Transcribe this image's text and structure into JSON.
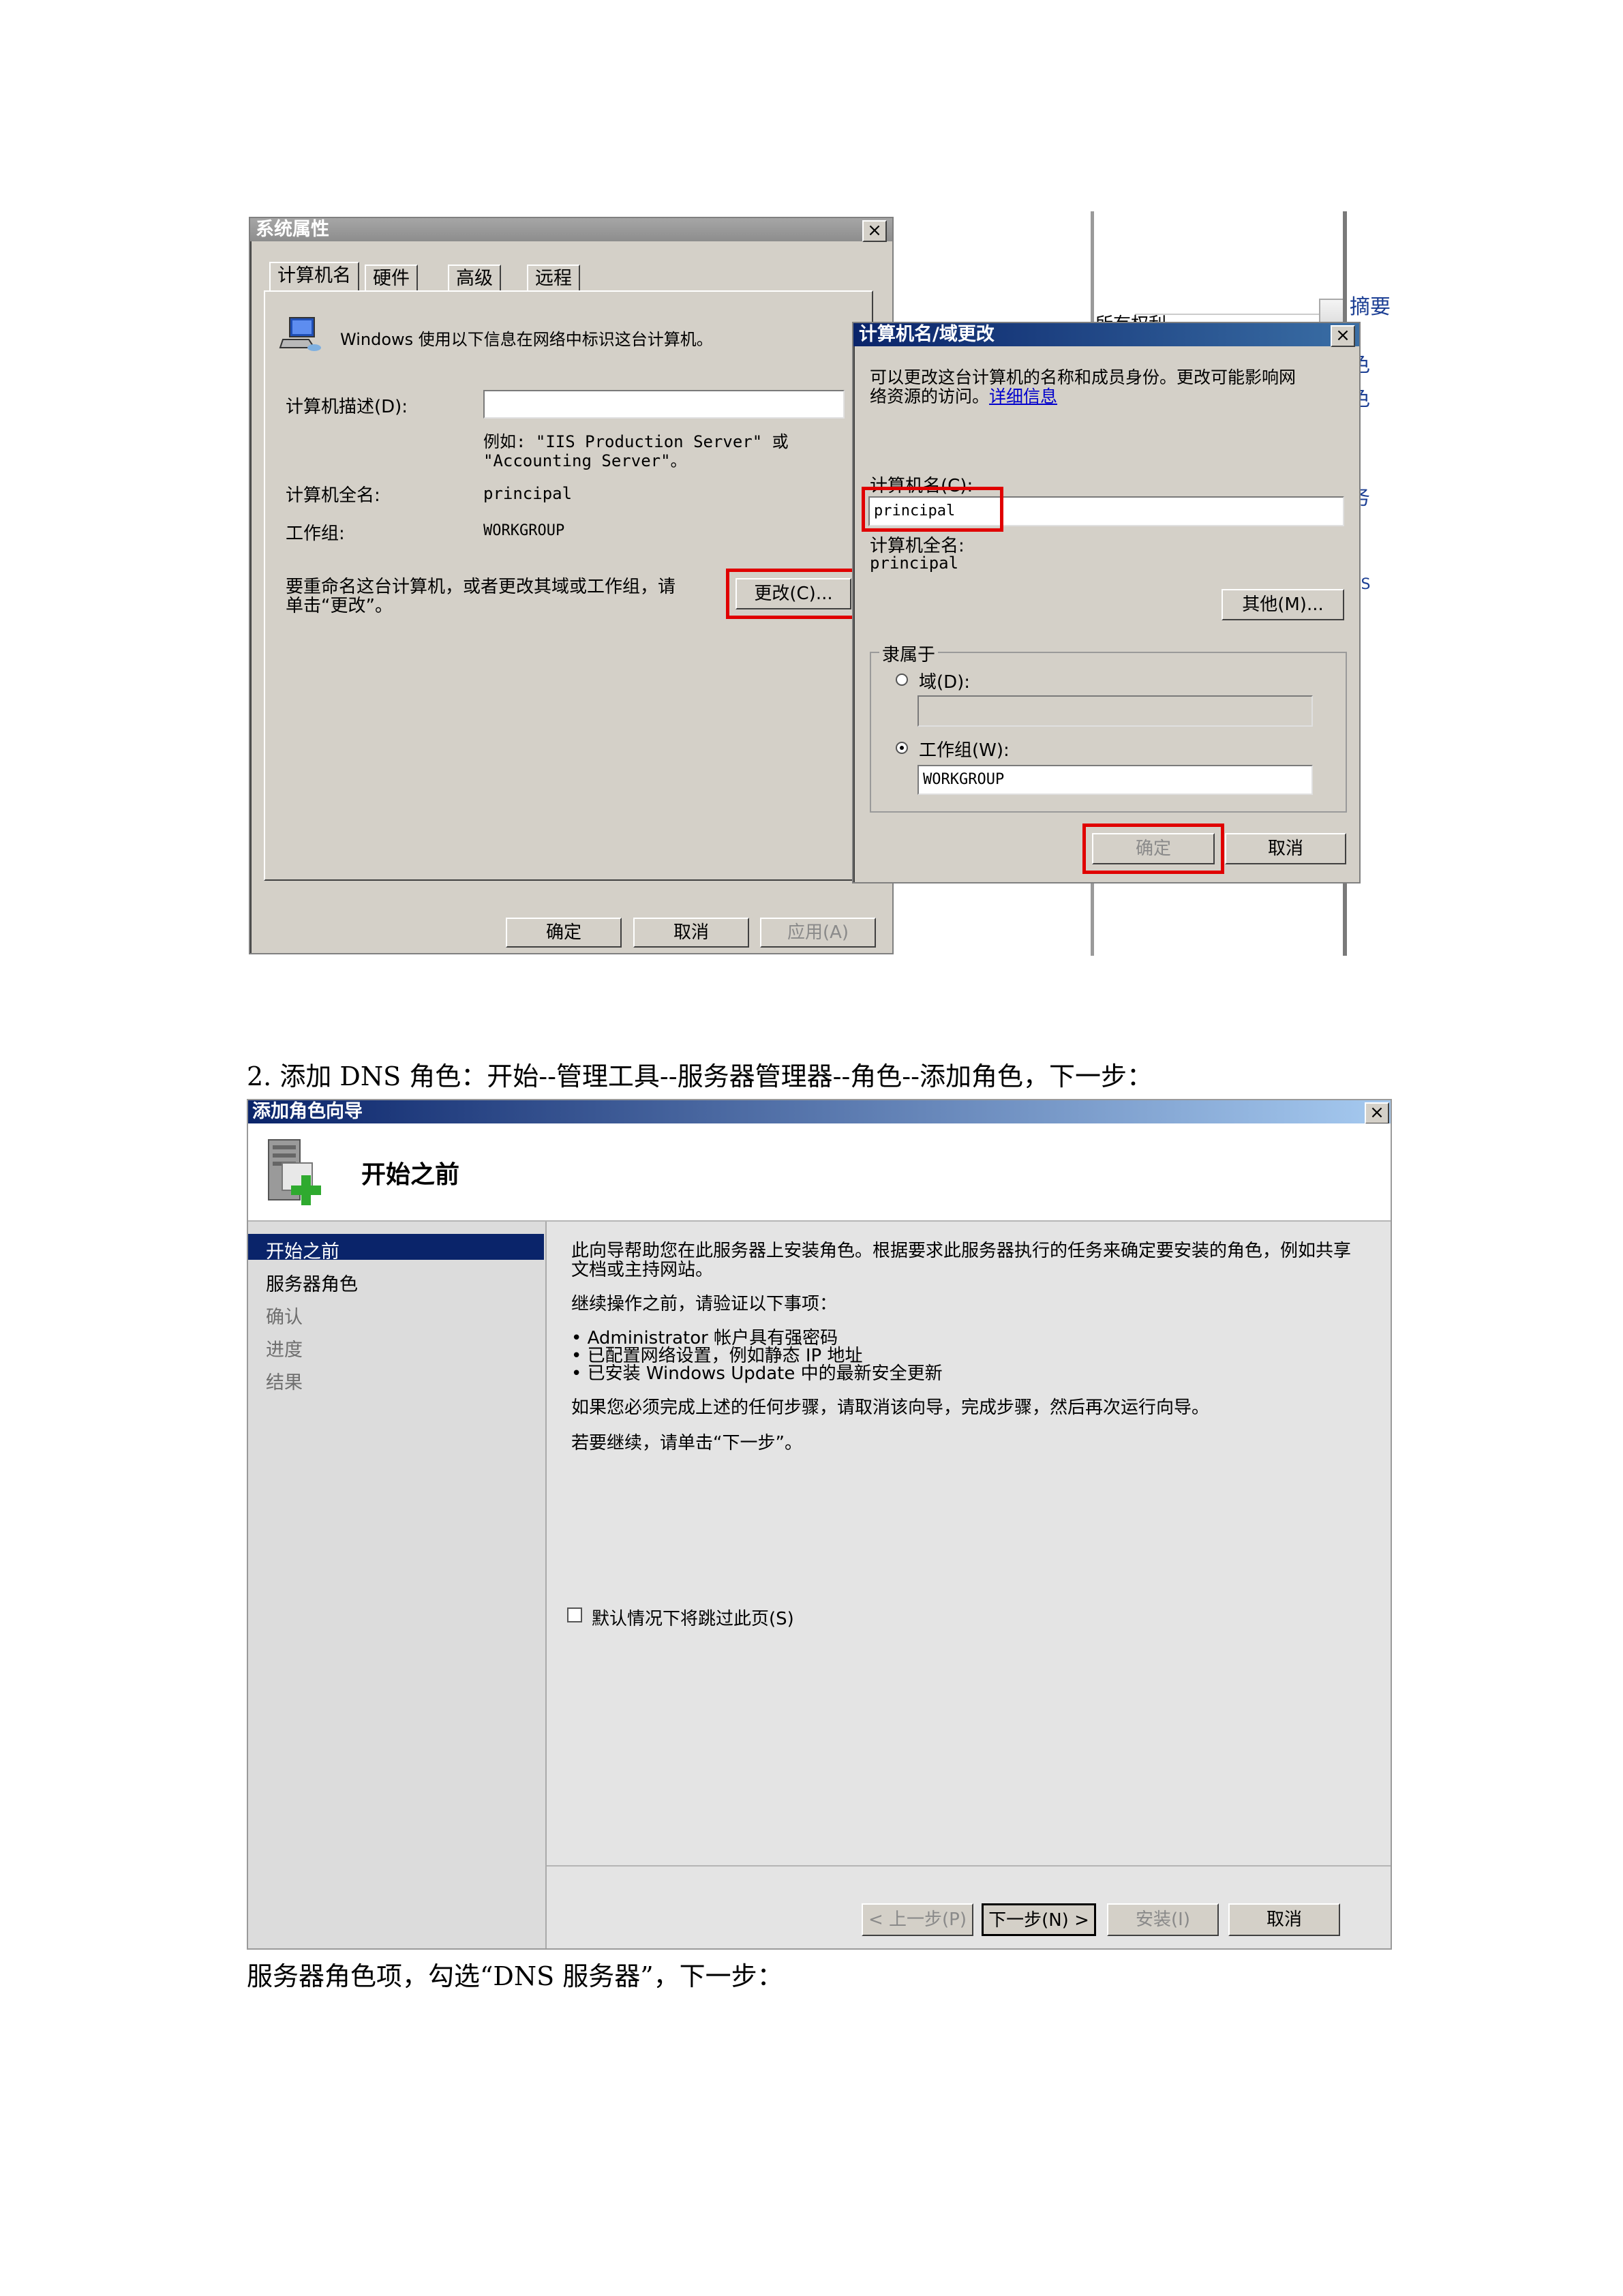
{
  "figure1": {
    "background_fragments": {
      "left_title": "所有权利",
      "right_items": [
        "摘要",
        "色",
        "色",
        "务",
        "NS"
      ]
    },
    "system_properties": {
      "title": "系统属性",
      "close_label": "×",
      "tabs": [
        "计算机名",
        "硬件",
        "高级",
        "远程"
      ],
      "intro": "Windows 使用以下信息在网络中标识这台计算机。",
      "description_label": "计算机描述(D):",
      "description_value": "",
      "example_line1": "例如: \"IIS Production Server\" 或",
      "example_line2": "\"Accounting Server\"。",
      "full_name_label": "计算机全名:",
      "full_name_value": "principal",
      "workgroup_label": "工作组:",
      "workgroup_value": "WORKGROUP",
      "rename_line1": "要重命名这台计算机，或者更改其域或工作组，请",
      "rename_line2": "单击“更改”。",
      "change_button": "更改(C)...",
      "ok_button": "确定",
      "cancel_button": "取消",
      "apply_button": "应用(A)"
    },
    "name_change": {
      "title": "计算机名/域更改",
      "close_label": "×",
      "info_line1": "可以更改这台计算机的名称和成员身份。更改可能影响网",
      "info_line2_prefix": "络资源的访问。",
      "info_link": "详细信息",
      "computer_name_label": "计算机名(C):",
      "computer_name_value": "principal",
      "full_name_label": "计算机全名:",
      "full_name_value": "principal",
      "more_button": "其他(M)...",
      "member_of_label": "隶属于",
      "domain_label": "域(D):",
      "domain_value": "",
      "workgroup_label": "工作组(W):",
      "workgroup_value": "WORKGROUP",
      "ok_button": "确定",
      "cancel_button": "取消"
    }
  },
  "caption1": "2. 添加 DNS 角色：开始--管理工具--服务器管理器--角色--添加角色，下一步：",
  "figure2": {
    "window_title": "添加角色向导",
    "close_label": "×",
    "header_title": "开始之前",
    "steps": [
      "开始之前",
      "服务器角色",
      "确认",
      "进度",
      "结果"
    ],
    "active_step": 0,
    "intro_line1": "此向导帮助您在此服务器上安装角色。根据要求此服务器执行的任务来确定要安装的角色，例如共享",
    "intro_line2": "文档或主持网站。",
    "verify_heading": "继续操作之前，请验证以下事项：",
    "bullets": [
      "• Administrator 帐户具有强密码",
      "• 已配置网络设置，例如静态 IP 地址",
      "• 已安装 Windows Update 中的最新安全更新"
    ],
    "cancel_hint": "如果您必须完成上述的任何步骤，请取消该向导，完成步骤，然后再次运行向导。",
    "continue_hint": "若要继续，请单击“下一步”。",
    "skip_checkbox_label": "默认情况下将跳过此页(S)",
    "skip_checked": false,
    "back_button": "< 上一步(P)",
    "next_button": "下一步(N) >",
    "install_button": "安装(I)",
    "cancel_button": "取消"
  },
  "caption2": "服务器角色项，勾选“DNS 服务器”，下一步："
}
